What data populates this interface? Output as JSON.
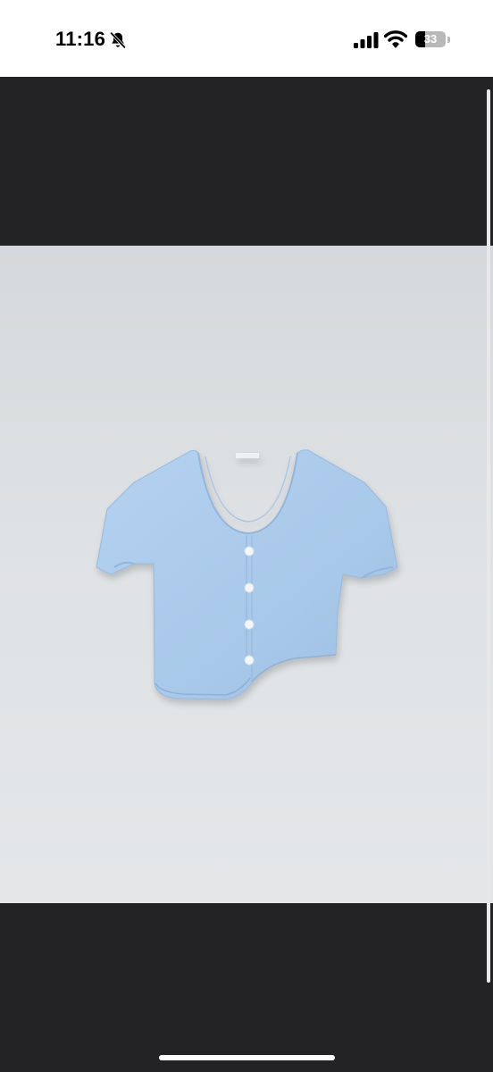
{
  "status_bar": {
    "time": "11:16",
    "battery_level": "33",
    "battery_fraction": 0.33,
    "icons": [
      "bell-slash-icon",
      "cellular-signal-icon",
      "wifi-icon",
      "battery-icon"
    ]
  },
  "viewer": {
    "background_color": "#232325",
    "image_subject": "light-blue-knit-crop-cardigan"
  },
  "colors": {
    "garment": "#a9c9ea",
    "backdrop": "#dfe2e5"
  }
}
